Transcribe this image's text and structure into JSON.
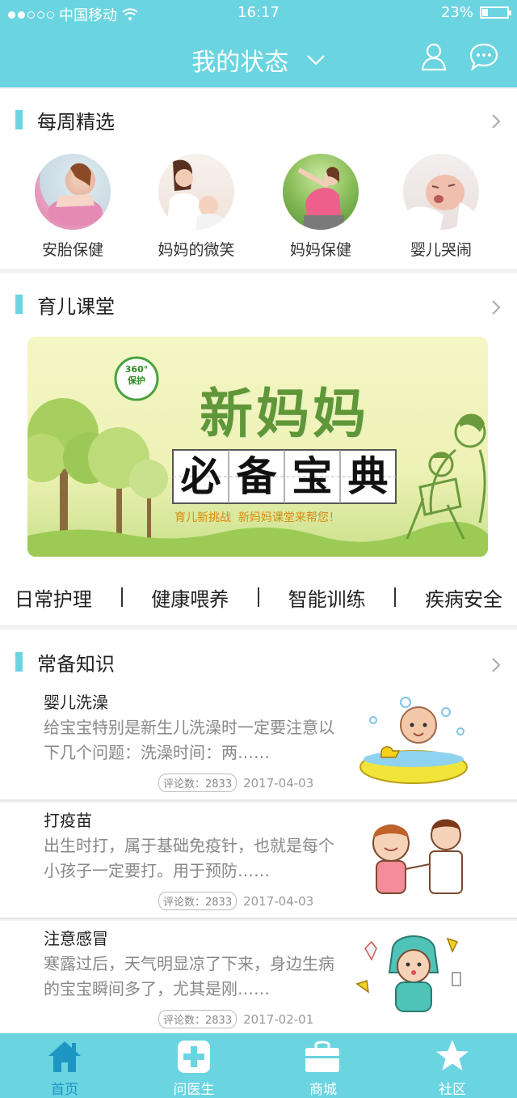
{
  "status_bar": {
    "carrier": "中国移动",
    "time": "16:17",
    "battery": "23%"
  },
  "header": {
    "title": "我的状态"
  },
  "weekly": {
    "title": "每周精选",
    "items": [
      {
        "label": "安胎保健"
      },
      {
        "label": "妈妈的微笑"
      },
      {
        "label": "妈妈保健"
      },
      {
        "label": "婴儿哭闹"
      }
    ]
  },
  "course": {
    "title": "育儿课堂",
    "banner": {
      "badge_top": "360°",
      "badge_bottom": "保护",
      "headline": "新妈妈",
      "chars": [
        "必",
        "备",
        "宝",
        "典"
      ],
      "slogan": "育儿新挑战  新妈妈课堂来帮您！"
    },
    "categories": [
      "日常护理",
      "健康喂养",
      "智能训练",
      "疾病安全"
    ]
  },
  "knowledge": {
    "title": "常备知识",
    "articles": [
      {
        "title": "婴儿洗澡",
        "desc": "给宝宝特别是新生儿洗澡时一定要注意以下几个问题：洗澡时间：两……",
        "comments_label": "评论数：2833",
        "date": "2017-04-03"
      },
      {
        "title": "打疫苗",
        "desc": "出生时打，属于基础免疫针，也就是每个小孩子一定要打。用于预防……",
        "comments_label": "评论数：2833",
        "date": "2017-04-03"
      },
      {
        "title": "注意感冒",
        "desc": "寒露过后，天气明显凉了下来，身边生病的宝宝瞬间多了，尤其是刚……",
        "comments_label": "评论数：2833",
        "date": "2017-02-01"
      }
    ]
  },
  "tabbar": {
    "tabs": [
      {
        "label": "首页",
        "icon": "home-icon",
        "active": true
      },
      {
        "label": "问医生",
        "icon": "medical-cross-icon",
        "active": false
      },
      {
        "label": "商城",
        "icon": "shopping-bag-icon",
        "active": false
      },
      {
        "label": "社区",
        "icon": "star-icon",
        "active": false
      }
    ]
  },
  "colors": {
    "accent": "#6bd4e1",
    "active_tab": "#1e96c4"
  }
}
